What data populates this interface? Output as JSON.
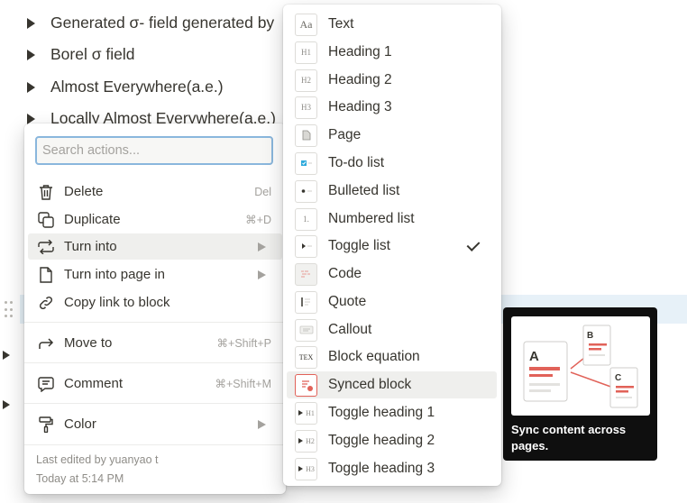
{
  "background": {
    "toggles": [
      {
        "label": "Generated σ- field generated by"
      },
      {
        "label": "Borel σ field"
      },
      {
        "label": "Almost Everywhere(a.e.)"
      },
      {
        "label": "Locally Almost Everywhere(a.e.)"
      }
    ]
  },
  "actions_menu": {
    "search_placeholder": "Search actions...",
    "items": [
      {
        "label": "Delete",
        "shortcut": "Del",
        "icon": "trash-icon"
      },
      {
        "label": "Duplicate",
        "shortcut": "⌘+D",
        "icon": "duplicate-icon"
      },
      {
        "label": "Turn into",
        "icon": "turn-into-icon",
        "submenu": true
      },
      {
        "label": "Turn into page in",
        "icon": "page-icon",
        "submenu": true
      },
      {
        "label": "Copy link to block",
        "icon": "link-icon"
      },
      {
        "label": "Move to",
        "shortcut": "⌘+Shift+P",
        "icon": "move-arrow-icon"
      },
      {
        "label": "Comment",
        "shortcut": "⌘+Shift+M",
        "icon": "comment-icon"
      },
      {
        "label": "Color",
        "icon": "paint-roller-icon",
        "submenu": true
      }
    ],
    "footer": {
      "edited_by": "Last edited by yuanyao t",
      "time": "Today at 5:14 PM"
    }
  },
  "turn_into_menu": {
    "items": [
      {
        "label": "Text",
        "icon": "text-icon",
        "glyph": "Aa"
      },
      {
        "label": "Heading 1",
        "icon": "heading-1-icon",
        "glyph": "H1"
      },
      {
        "label": "Heading 2",
        "icon": "heading-2-icon",
        "glyph": "H2"
      },
      {
        "label": "Heading 3",
        "icon": "heading-3-icon",
        "glyph": "H3"
      },
      {
        "label": "Page",
        "icon": "page-icon",
        "glyph": ""
      },
      {
        "label": "To-do list",
        "icon": "todo-icon",
        "glyph": ""
      },
      {
        "label": "Bulleted list",
        "icon": "bulleted-list-icon",
        "glyph": ""
      },
      {
        "label": "Numbered list",
        "icon": "numbered-list-icon",
        "glyph": "1."
      },
      {
        "label": "Toggle list",
        "icon": "toggle-list-icon",
        "glyph": "",
        "checked": true
      },
      {
        "label": "Code",
        "icon": "code-icon",
        "glyph": ""
      },
      {
        "label": "Quote",
        "icon": "quote-icon",
        "glyph": ""
      },
      {
        "label": "Callout",
        "icon": "callout-icon",
        "glyph": ""
      },
      {
        "label": "Block equation",
        "icon": "equation-icon",
        "glyph": "TEX"
      },
      {
        "label": "Synced block",
        "icon": "synced-block-icon",
        "glyph": ""
      },
      {
        "label": "Toggle heading 1",
        "icon": "toggle-heading-1-icon",
        "glyph": "H1"
      },
      {
        "label": "Toggle heading 2",
        "icon": "toggle-heading-2-icon",
        "glyph": "H2"
      },
      {
        "label": "Toggle heading 3",
        "icon": "toggle-heading-3-icon",
        "glyph": "H3"
      }
    ]
  },
  "preview": {
    "description": "Sync content across pages.",
    "card_letters": [
      "A",
      "B",
      "C"
    ]
  },
  "colors": {
    "accent_red": "#e16259",
    "highlight": "#e7f1f8",
    "focus_ring": "#8ab7dd"
  }
}
